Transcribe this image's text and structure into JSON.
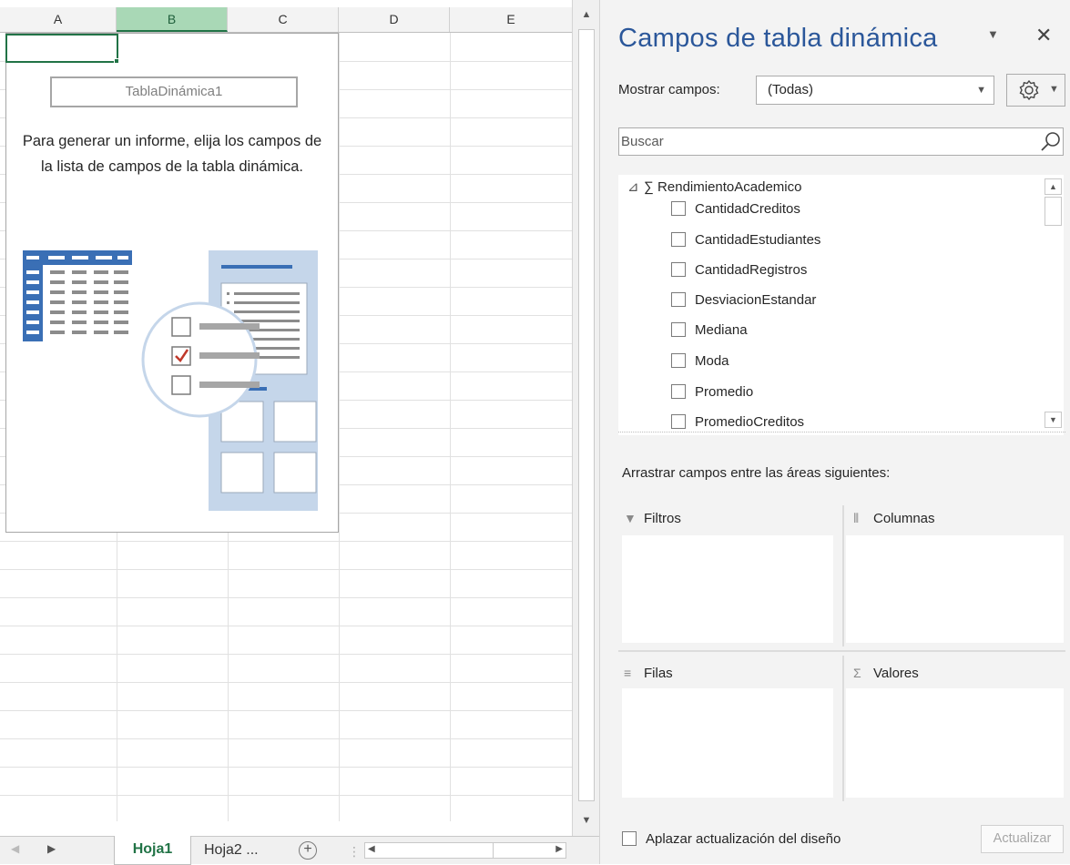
{
  "sheet": {
    "columns": [
      "A",
      "B",
      "C",
      "D",
      "E"
    ],
    "selected_column": "B",
    "pivot": {
      "name": "TablaDinámica1",
      "instructions": "Para generar un informe, elija los campos de la lista de campos de la tabla dinámica."
    },
    "tabs": {
      "active": "Hoja1",
      "next": "Hoja2 ..."
    }
  },
  "pane": {
    "title": "Campos de tabla dinámica",
    "show_fields_label": "Mostrar campos:",
    "show_fields_value": "(Todas)",
    "search_placeholder": "Buscar",
    "table_name": "RendimientoAcademico",
    "fields": [
      {
        "label": "CantidadCreditos",
        "checked": false
      },
      {
        "label": "CantidadEstudiantes",
        "checked": false
      },
      {
        "label": "CantidadRegistros",
        "checked": false
      },
      {
        "label": "DesviacionEstandar",
        "checked": false
      },
      {
        "label": "Mediana",
        "checked": false
      },
      {
        "label": "Moda",
        "checked": false
      },
      {
        "label": "Promedio",
        "checked": false
      },
      {
        "label": "PromedioCreditos",
        "checked": false
      }
    ],
    "drag_label": "Arrastrar campos entre las áreas siguientes:",
    "areas": {
      "filters": "Filtros",
      "columns": "Columnas",
      "rows": "Filas",
      "values": "Valores"
    },
    "defer_label": "Aplazar actualización del diseño",
    "update_button": "Actualizar"
  },
  "icons": {
    "close": "close-icon",
    "gear": "gear-icon",
    "search": "search-icon",
    "filter": "filter-icon",
    "columns": "columns-icon",
    "rows": "rows-icon",
    "sigma": "sigma-icon"
  },
  "colors": {
    "excel_green": "#217346",
    "title_blue": "#2b579a",
    "illustration_blue": "#3a6fb5",
    "check_red": "#c0392b"
  }
}
